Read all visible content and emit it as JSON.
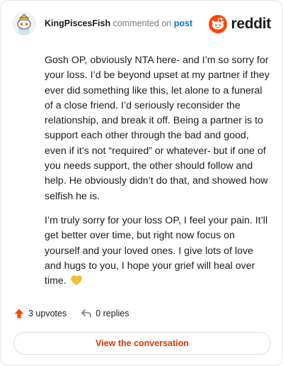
{
  "header": {
    "author": "KingPiscesFish",
    "commented_on": "commented on",
    "post_link": "post",
    "brand": "reddit"
  },
  "comment": {
    "paragraphs": [
      "Gosh OP, obviously NTA here- and I’m so sorry for your loss. I’d be beyond upset at my partner if they ever did something like this, let alone to a funeral of a close friend. I’d seriously reconsider the relationship, and break it off. Being a partner is to support each other through the bad and good, even if it’s not “required” or whatever- but if one of you needs support, the other should follow and help. He obviously didn’t do that, and showed how selfish he is.",
      "I’m truly sorry for your loss OP, I feel your pain. It’ll get better over time, but right now focus on yourself and your loved ones. I give lots of love and hugs to you, I hope your grief will heal over time."
    ],
    "emoji": "yellow-heart-icon"
  },
  "footer": {
    "upvotes": "3 upvotes",
    "replies": "0 replies"
  },
  "actions": {
    "view_conversation": "View the conversation"
  },
  "colors": {
    "brand_orange": "#ff4500",
    "link_blue": "#0079d3",
    "button_text": "#d93a00",
    "heart_yellow": "#f7c12e"
  }
}
